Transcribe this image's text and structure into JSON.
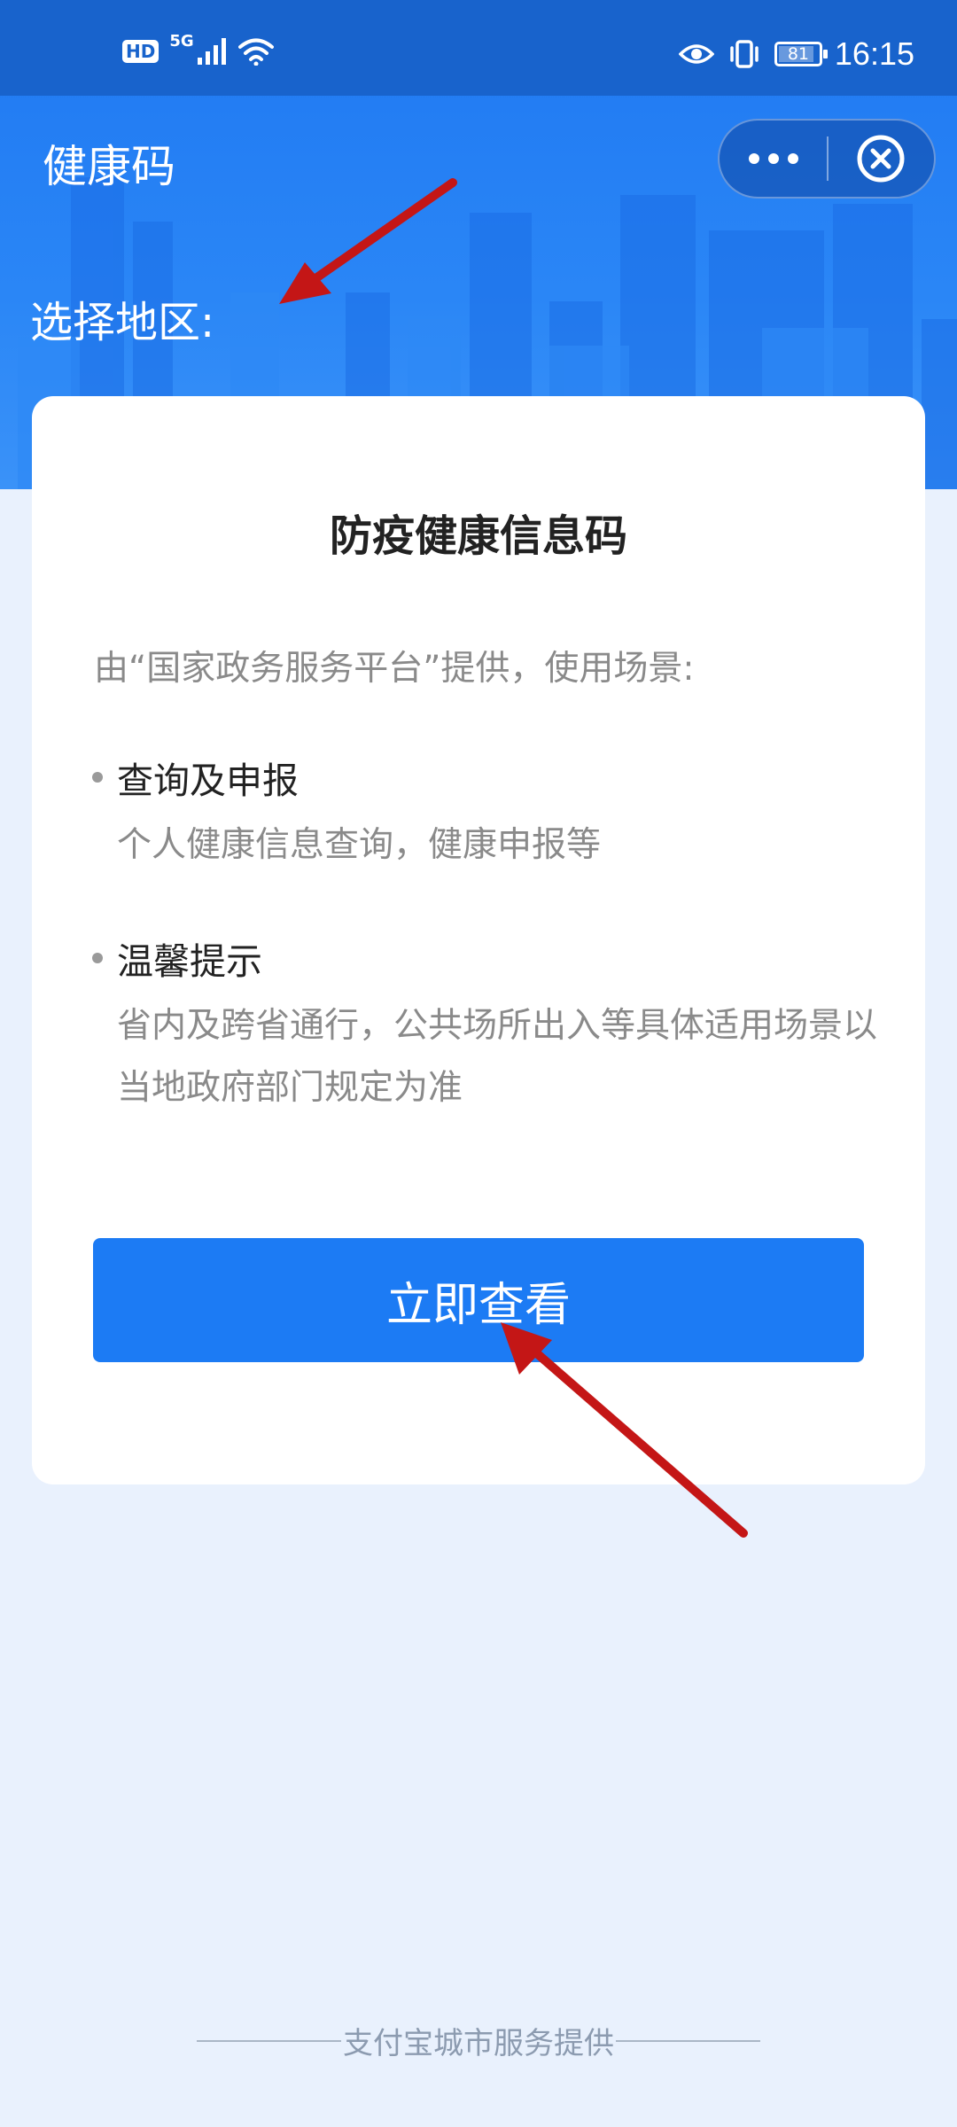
{
  "status_bar": {
    "hd_badge": "HD",
    "network": "5G",
    "battery_level": "81",
    "time": "16:15"
  },
  "header": {
    "title": "健康码",
    "region_label": "选择地区:"
  },
  "capsule": {
    "more_icon": "more-dots-icon",
    "close_icon": "close-circle-icon"
  },
  "card": {
    "title": "防疫健康信息码",
    "subtitle": "由“国家政务服务平台”提供，使用场景:",
    "sections": [
      {
        "title": "查询及申报",
        "description": "个人健康信息查询，健康申报等"
      },
      {
        "title": "温馨提示",
        "description": "省内及跨省通行，公共场所出入等具体适用场景以当地政府部门规定为准"
      }
    ],
    "cta_label": "立即查看"
  },
  "footer": {
    "text": "支付宝城市服务提供"
  },
  "colors": {
    "header_blue": "#1f78f1",
    "status_bar": "#1863cc",
    "button_blue": "#1c7bf4",
    "page_bg": "#e9f1fd",
    "annotation_arrow": "#c41616"
  }
}
